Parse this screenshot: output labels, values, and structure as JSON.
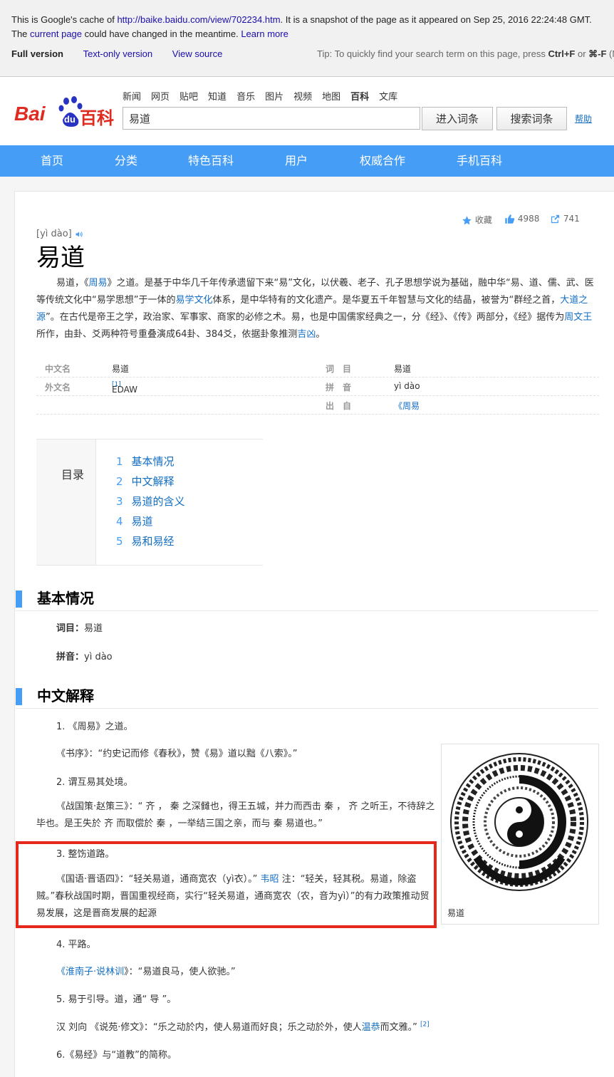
{
  "cache_banner": {
    "line1_prefix": "This is Google's cache of ",
    "line1_url": "http://baike.baidu.com/view/702234.htm",
    "line1_suffix": ". It is a snapshot of the page as it appeared on Sep 25, 2016 22:24:48 GMT.",
    "line2_prefix": "The ",
    "line2_link": "current page",
    "line2_middle": " could have changed in the meantime. ",
    "line2_learn": "Learn more",
    "full_version": "Full version",
    "text_only": "Text-only version",
    "view_source": "View source",
    "tip_prefix": "Tip: To quickly find your search term on this page, press ",
    "tip_keys1": "Ctrl+F",
    "tip_or": " or ",
    "tip_keys2": "⌘-F",
    "tip_suffix": " (M"
  },
  "header": {
    "logo_text_bai": "Bai",
    "logo_text_du": "du",
    "logo_text_baike": "百科",
    "nav": [
      "新闻",
      "网页",
      "贴吧",
      "知道",
      "音乐",
      "图片",
      "视频",
      "地图",
      "百科",
      "文库"
    ],
    "nav_active": "百科",
    "search_value": "易道",
    "enter_button": "进入词条",
    "search_button": "搜索词条",
    "help": "帮助"
  },
  "main_nav": [
    "首页",
    "分类",
    "特色百科",
    "用户",
    "权威合作",
    "手机百科"
  ],
  "article": {
    "tools": {
      "collect": "收藏",
      "likes": "4988",
      "shares": "741"
    },
    "pinyin": "[yì dào]",
    "title": "易道",
    "summary": {
      "s1": "易道，《",
      "l1": "周易",
      "s2": "》之道。是基于中华几千年传承遗留下来“易”文化，以伏羲、老子、孔子思想学说为基础，融中华“易、道、儒、武、医等传统文化中“易学思想”于一体的",
      "l2": "易学文化",
      "s3": "体系，是中华特有的文化遗产。是华夏五千年智慧与文化的结晶，被誉为“群经之首，",
      "l3": "大道之源",
      "s4": "”。在古代是帝王之学，政治家、军事家、商家的必修之术。易，也是中国儒家经典之一，分《经》、《传》两部分，《经》据传为",
      "l4": "周文王",
      "s5": "所作，由卦、爻两种符号重叠演成64卦、384爻，依据卦象推测",
      "l5": "吉凶",
      "s6": "。"
    },
    "basic_info": {
      "left": [
        {
          "key": "中文名",
          "value": "易道"
        },
        {
          "key": "外文名",
          "value": "EDAW",
          "sup": "[1]"
        }
      ],
      "right": [
        {
          "key": "词　目",
          "value": "易道"
        },
        {
          "key": "拼　音",
          "value": "yì dào"
        },
        {
          "key": "出　自",
          "value": "《周易"
        }
      ]
    },
    "toc": {
      "label": "目录",
      "items": [
        {
          "num": "1",
          "text": "基本情况"
        },
        {
          "num": "2",
          "text": "中文解释"
        },
        {
          "num": "3",
          "text": "易道的含义"
        },
        {
          "num": "4",
          "text": "易道"
        },
        {
          "num": "5",
          "text": "易和易经"
        }
      ]
    },
    "sections": {
      "basic": {
        "title": "基本情况",
        "ci_label": "词目：",
        "ci_value": "易道",
        "pin_label": "拼音：",
        "pin_value": "yì dào"
      },
      "chinese": {
        "title": "中文解释",
        "p1": "1. 《周易》之道。",
        "p2": "《书序》：“约史记而修《春秋》，赞《易》道以黜《八索》。”",
        "p3": "2. 谓互易其处境。",
        "p4": "《战国策·赵策三》：“ 齐 ， 秦 之深雠也，得王五城，并力而西击 秦 ， 齐 之听王，不待辞之毕也。是王失於 齐 而取偿於 秦 ，一举结三国之亲，而与 秦 易道也。”",
        "p5": "3. 整饬道路。",
        "p6a": "《国语·晋语四》：“轻关易道，通商宽农（yì衣）。” ",
        "p6link": "韦昭",
        "p6b": " 注：“轻关，轻其税。易道，除盗贼。”春秋战国时期，晋国重视经商，实行“轻关易道，通商宽农（农，音为yì）”的有力政策推动贸易发展，这是晋商发展的起源",
        "p7": "4. 平路。",
        "p8link": "《淮南子·说林训",
        "p8b": "》：“易道良马，使人欲驰。”",
        "p9": "5. 易于引导。道，通“ 导 ”。",
        "p10a": "汉 刘向 《说苑·修文》：“乐之动於内，使人易道而好良；乐之动於外，使人",
        "p10link": "温恭",
        "p10b": "而文雅。”",
        "p10sup": "[2]",
        "p11": "6.《易经》与“道教”的简称。",
        "image_caption": "易道"
      }
    }
  },
  "colors": {
    "nav_blue": "#459df5",
    "link_blue": "#136ec2",
    "highlight_red": "#e5271c",
    "logo_red": "#de2a1f",
    "logo_blue": "#2832c3"
  }
}
